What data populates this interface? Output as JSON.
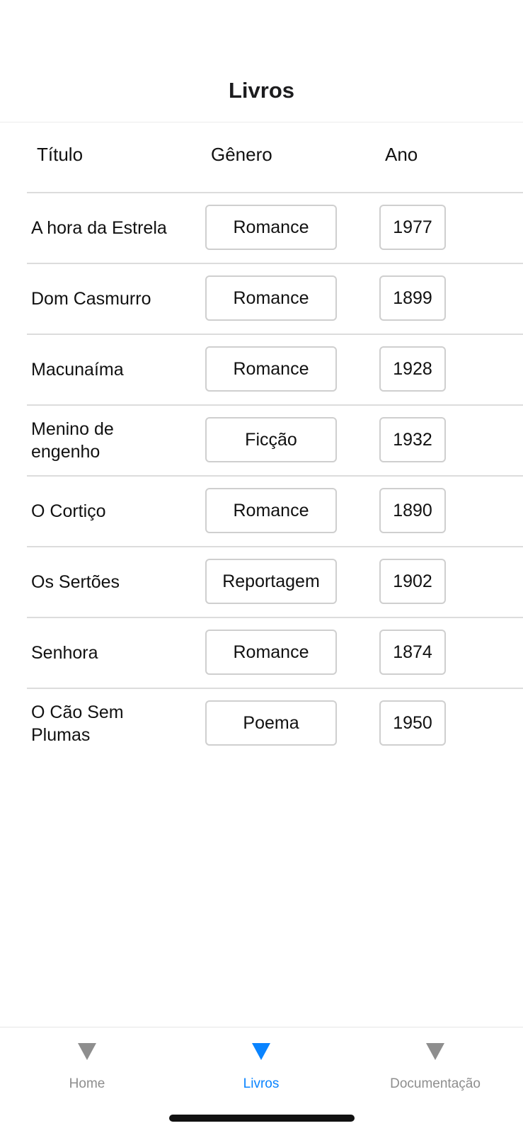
{
  "header": {
    "title": "Livros"
  },
  "table": {
    "columns": [
      "Título",
      "Gênero",
      "Ano"
    ],
    "rows": [
      {
        "title": "A hora da Estrela",
        "genre": "Romance",
        "year": "1977"
      },
      {
        "title": "Dom Casmurro",
        "genre": "Romance",
        "year": "1899"
      },
      {
        "title": "Macunaíma",
        "genre": "Romance",
        "year": "1928"
      },
      {
        "title": "Menino de engenho",
        "genre": "Ficção",
        "year": "1932"
      },
      {
        "title": "O Cortiço",
        "genre": "Romance",
        "year": "1890"
      },
      {
        "title": "Os Sertões",
        "genre": "Reportagem",
        "year": "1902"
      },
      {
        "title": "Senhora",
        "genre": "Romance",
        "year": "1874"
      },
      {
        "title": "O Cão Sem Plumas",
        "genre": "Poema",
        "year": "1950"
      }
    ]
  },
  "tabbar": {
    "tabs": [
      {
        "label": "Home",
        "icon": "triangle-down-icon",
        "active": false
      },
      {
        "label": "Livros",
        "icon": "triangle-down-icon",
        "active": true
      },
      {
        "label": "Documentação",
        "icon": "triangle-down-icon",
        "active": false
      }
    ],
    "active_color": "#0a84ff",
    "inactive_color": "#8e8e8e"
  }
}
